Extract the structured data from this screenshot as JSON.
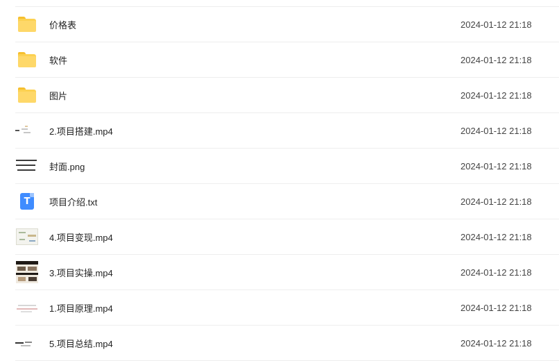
{
  "files": [
    {
      "name": "价格表",
      "date": "2024-01-12 21:18",
      "type": "folder",
      "icon": "folder-icon"
    },
    {
      "name": "软件",
      "date": "2024-01-12 21:18",
      "type": "folder",
      "icon": "folder-icon"
    },
    {
      "name": "图片",
      "date": "2024-01-12 21:18",
      "type": "folder",
      "icon": "folder-icon"
    },
    {
      "name": "2.项目搭建.mp4",
      "date": "2024-01-12 21:18",
      "type": "video",
      "icon": "video-thumbnail-icon"
    },
    {
      "name": "封面.png",
      "date": "2024-01-12 21:18",
      "type": "image",
      "icon": "image-thumbnail-icon"
    },
    {
      "name": "项目介绍.txt",
      "date": "2024-01-12 21:18",
      "type": "text",
      "icon": "text-file-icon",
      "icon_glyph": "T"
    },
    {
      "name": "4.项目变现.mp4",
      "date": "2024-01-12 21:18",
      "type": "video",
      "icon": "video-thumbnail-icon"
    },
    {
      "name": "3.项目实操.mp4",
      "date": "2024-01-12 21:18",
      "type": "video",
      "icon": "video-thumbnail-icon"
    },
    {
      "name": "1.项目原理.mp4",
      "date": "2024-01-12 21:18",
      "type": "video",
      "icon": "video-thumbnail-icon"
    },
    {
      "name": "5.项目总结.mp4",
      "date": "2024-01-12 21:18",
      "type": "video",
      "icon": "video-thumbnail-icon"
    }
  ],
  "colors": {
    "folder": "#fcd151",
    "text_icon": "#3f8cff",
    "divider": "#eeeeee"
  }
}
